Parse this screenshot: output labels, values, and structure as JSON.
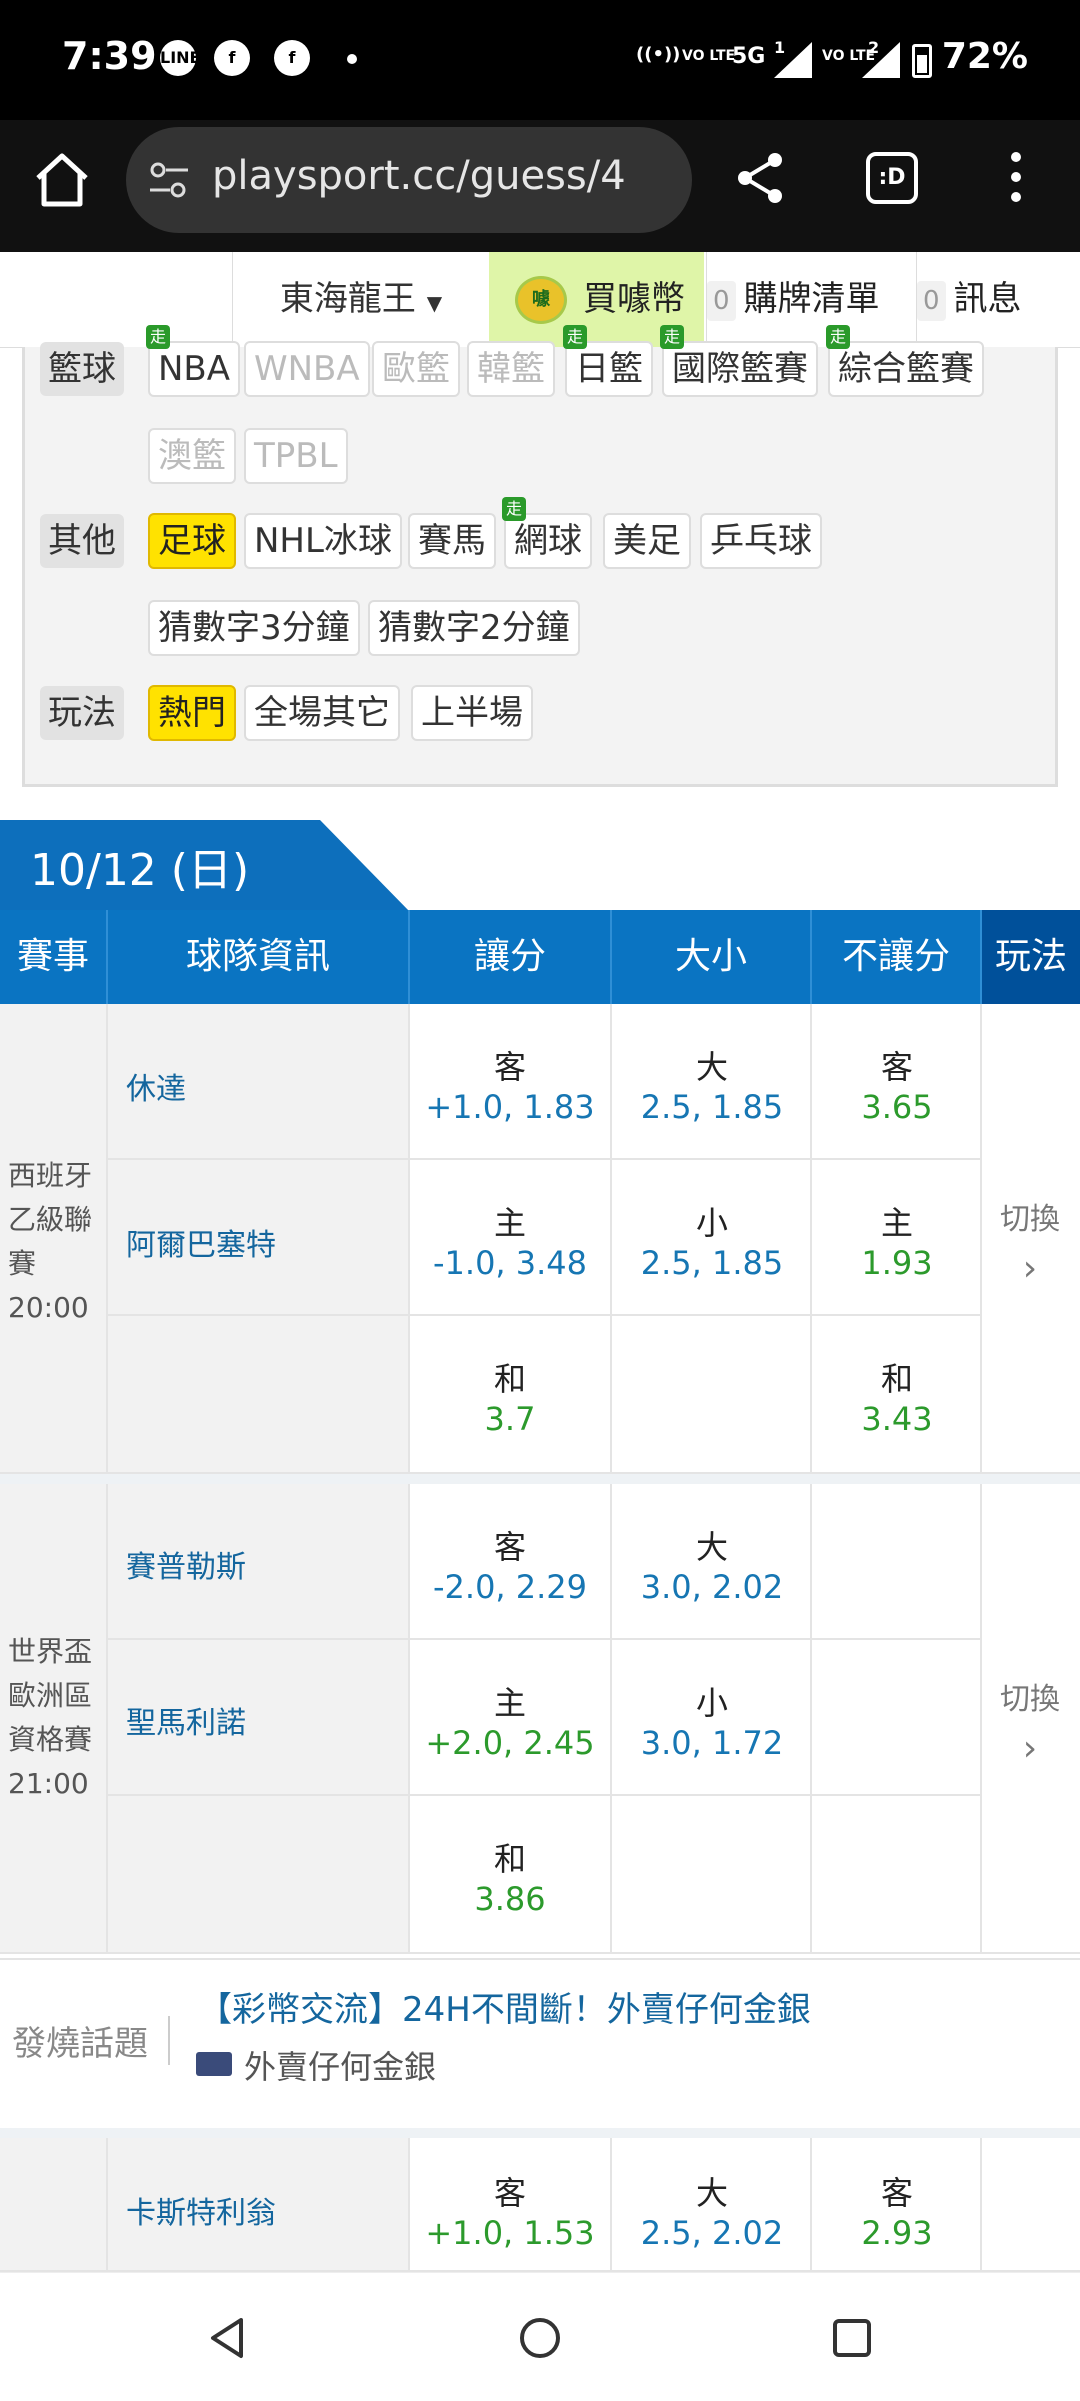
{
  "status": {
    "time": "7:39",
    "battery": "72%",
    "network": "5G",
    "sim1": "1",
    "sim2": "2",
    "lte1": "VO LTE",
    "lte2": "VO LTE",
    "battery_level": 0.72
  },
  "browser": {
    "url": "playsport.cc/guess/4",
    "tabs_badge": ":D"
  },
  "header": {
    "user_menu": "東海龍王",
    "buy_coin": "買噱幣",
    "coin_icon_text": "噱",
    "cart_count": "0",
    "cart_label": "購牌清單",
    "msg_count": "0",
    "msg_label": "訊息"
  },
  "filters": {
    "basketball": {
      "label": "籃球",
      "items": [
        "NBA",
        "WNBA",
        "歐籃",
        "韓籃",
        "日籃",
        "國際籃賽",
        "綜合籃賽",
        "澳籃",
        "TPBL"
      ]
    },
    "other": {
      "label": "其他",
      "items": [
        "足球",
        "NHL冰球",
        "賽馬",
        "網球",
        "美足",
        "乒乓球",
        "猜數字3分鐘",
        "猜數字2分鐘"
      ]
    },
    "play": {
      "label": "玩法",
      "items": [
        "熱門",
        "全場其它",
        "上半場"
      ]
    },
    "go_badge": "走"
  },
  "date": "10/12 (日)",
  "table_headers": [
    "賽事",
    "球隊資訊",
    "讓分",
    "大小",
    "不讓分",
    "玩法"
  ],
  "matches": [
    {
      "league": [
        "西班牙",
        "乙級聯",
        "賽"
      ],
      "time": "20:00",
      "away": "休達",
      "home": "阿爾巴塞特",
      "spread": {
        "away_label": "客",
        "away": "+1.0, 1.83",
        "home_label": "主",
        "home": "-1.0, 3.48",
        "draw_label": "和",
        "draw": "3.7"
      },
      "total": {
        "over_label": "大",
        "over": "2.5, 1.85",
        "under_label": "小",
        "under": "2.5, 1.85"
      },
      "moneyline": {
        "away_label": "客",
        "away": "3.65",
        "home_label": "主",
        "home": "1.93",
        "draw_label": "和",
        "draw": "3.43"
      },
      "switch": "切換"
    },
    {
      "league": [
        "世界盃",
        "歐洲區",
        "資格賽"
      ],
      "time": "21:00",
      "away": "賽普勒斯",
      "home": "聖馬利諾",
      "spread": {
        "away_label": "客",
        "away": "-2.0, 2.29",
        "home_label": "主",
        "home": "+2.0, 2.45",
        "draw_label": "和",
        "draw": "3.86"
      },
      "total": {
        "over_label": "大",
        "over": "3.0, 2.02",
        "under_label": "小",
        "under": "3.0, 1.72"
      },
      "switch": "切換"
    },
    {
      "away": "卡斯特利翁",
      "spread": {
        "away_label": "客",
        "away": "+1.0, 1.53"
      },
      "total": {
        "over_label": "大",
        "over": "2.5, 2.02"
      },
      "moneyline": {
        "away_label": "客",
        "away": "2.93"
      }
    }
  ],
  "hot_topic": {
    "label": "發燒話題",
    "title": "【彩幣交流】24H不間斷！外賣仔何金銀",
    "author": "外賣仔何金銀"
  }
}
